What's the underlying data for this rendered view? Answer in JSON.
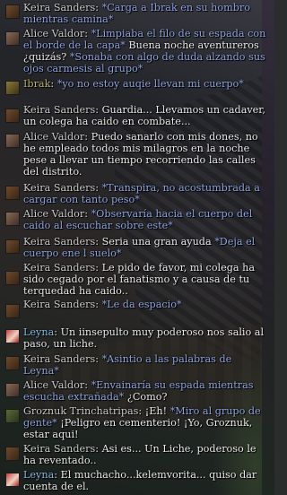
{
  "colors": {
    "speech": "#eaeaea",
    "emote": "#8ea3df",
    "name_default": "#c9c9c9",
    "name_ibrak": "#b7ad66",
    "name_leyna": "#87b7df"
  },
  "messages": [
    {
      "speaker": "Keira Sanders",
      "portrait": "keira-portrait",
      "text": "*Carga a Ibrak en su hombro mientras camina*",
      "kind": "emote"
    },
    {
      "speaker": "Alice Valdor",
      "portrait": "alice-portrait",
      "emote1": "*Limpiaba el filo de su espada con el borde de la capa*",
      "speech1": " Buena noche aventureros ¿quizás? ",
      "emote2": "*Sonaba con algo de duda alzando sus ojos carmesis al grupo*"
    },
    {
      "speaker": "Ibrak",
      "portrait": "ibrak-portrait",
      "text": "*yo no estoy auqie llevan mi cuerpo*",
      "kind": "emote"
    },
    {
      "speaker": "Keira Sanders",
      "portrait": "keira-portrait",
      "text": "Guardia... Llevamos un cadaver, un colega ha caido en combate...",
      "kind": "speech"
    },
    {
      "speaker": "Alice Valdor",
      "portrait": "alice-portrait",
      "text": "Puedo sanarlo con mis dones, no he empleado todos mis milagros en la noche pese a llevar un tiempo recorriendo las calles del distrito.",
      "kind": "speech"
    },
    {
      "speaker": "Keira Sanders",
      "portrait": "keira-portrait",
      "text": "*Transpira, no acostumbrada a cargar con tanto peso*",
      "kind": "emote"
    },
    {
      "speaker": "Alice Valdor",
      "portrait": "alice-portrait",
      "text": "*Observaría hacia el cuerpo del caido al escuchar sobre este*",
      "kind": "emote"
    },
    {
      "speaker": "Keira Sanders",
      "portrait": "keira-portrait",
      "speech1": "Seria una gran ayuda ",
      "emote1": "*Deja el cuerpo ene l suelo*"
    },
    {
      "speaker": "Keira Sanders",
      "portrait": "keira-portrait",
      "text": "Le pido de favor, mi colega ha sido cegado por el fanatismo y a causa de tu terquedad ha caido..",
      "kind": "speech"
    },
    {
      "speaker": "Keira Sanders",
      "portrait": "keira-portrait",
      "text": "*Le da espacio*",
      "kind": "emote"
    },
    {
      "speaker": "Leyna",
      "portrait": "leyna-portrait",
      "text": "Un iinsepulto muy poderoso nos salio al paso, un liche.",
      "kind": "speech"
    },
    {
      "speaker": "Keira Sanders",
      "portrait": "keira-portrait",
      "text": "*Asintio a las palabras de Leyna*",
      "kind": "emote"
    },
    {
      "speaker": "Alice Valdor",
      "portrait": "alice-portrait",
      "emote1": "*Envainaría su espada mientras escucha extrañada*",
      "speech1": " ¿Como?"
    },
    {
      "speaker": "Groznuk Trinchatripas",
      "portrait": "groznuk-portrait",
      "speech1": "¡Eh! ",
      "emote1": "*Miro al grupo de gente*",
      "speech2": " ¡Peligro en cementerio! ¡Yo, Groznuk, estar aqui!"
    },
    {
      "speaker": "Keira Sanders",
      "portrait": "keira-portrait",
      "text": "Asi es... Un Liche, poderoso le ha reventado..",
      "kind": "speech"
    },
    {
      "speaker": "Leyna",
      "portrait": "leyna-portrait",
      "text": "El muchacho...kelemvorita... quiso dar cuenta de el.",
      "kind": "speech"
    }
  ]
}
